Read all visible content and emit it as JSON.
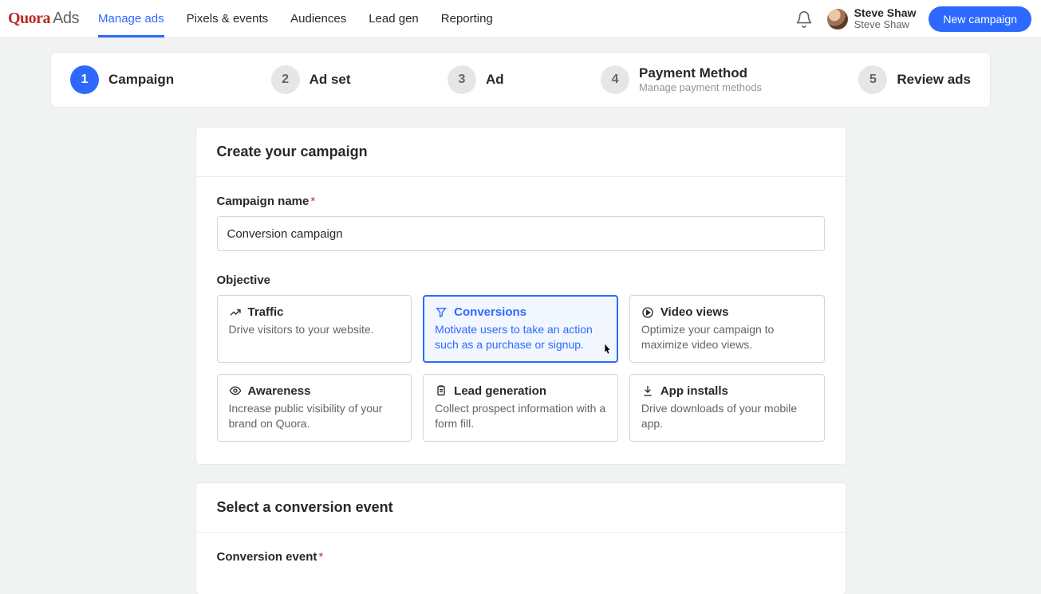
{
  "brand": {
    "q": "Quora",
    "ads": "Ads"
  },
  "nav": {
    "items": [
      {
        "label": "Manage ads",
        "active": true
      },
      {
        "label": "Pixels & events"
      },
      {
        "label": "Audiences"
      },
      {
        "label": "Lead gen"
      },
      {
        "label": "Reporting"
      }
    ]
  },
  "user": {
    "name": "Steve Shaw",
    "sub": "Steve Shaw"
  },
  "new_campaign_btn": "New campaign",
  "stepper": [
    {
      "num": "1",
      "label": "Campaign",
      "active": true
    },
    {
      "num": "2",
      "label": "Ad set"
    },
    {
      "num": "3",
      "label": "Ad"
    },
    {
      "num": "4",
      "label": "Payment Method",
      "sub": "Manage payment methods"
    },
    {
      "num": "5",
      "label": "Review ads"
    }
  ],
  "create": {
    "title": "Create your campaign",
    "name_label": "Campaign name",
    "name_value": "Conversion campaign",
    "objective_label": "Objective",
    "objectives": [
      {
        "icon": "trend",
        "title": "Traffic",
        "desc": "Drive visitors to your website."
      },
      {
        "icon": "funnel",
        "title": "Conversions",
        "desc": "Motivate users to take an action such as a purchase or signup.",
        "selected": true
      },
      {
        "icon": "play",
        "title": "Video views",
        "desc": "Optimize your campaign to maximize video views."
      },
      {
        "icon": "eye",
        "title": "Awareness",
        "desc": "Increase public visibility of your brand on Quora."
      },
      {
        "icon": "clipboard",
        "title": "Lead generation",
        "desc": "Collect prospect information with a form fill."
      },
      {
        "icon": "download",
        "title": "App installs",
        "desc": "Drive downloads of your mobile app."
      }
    ]
  },
  "conversion_card": {
    "title": "Select a conversion event",
    "event_label": "Conversion event"
  }
}
